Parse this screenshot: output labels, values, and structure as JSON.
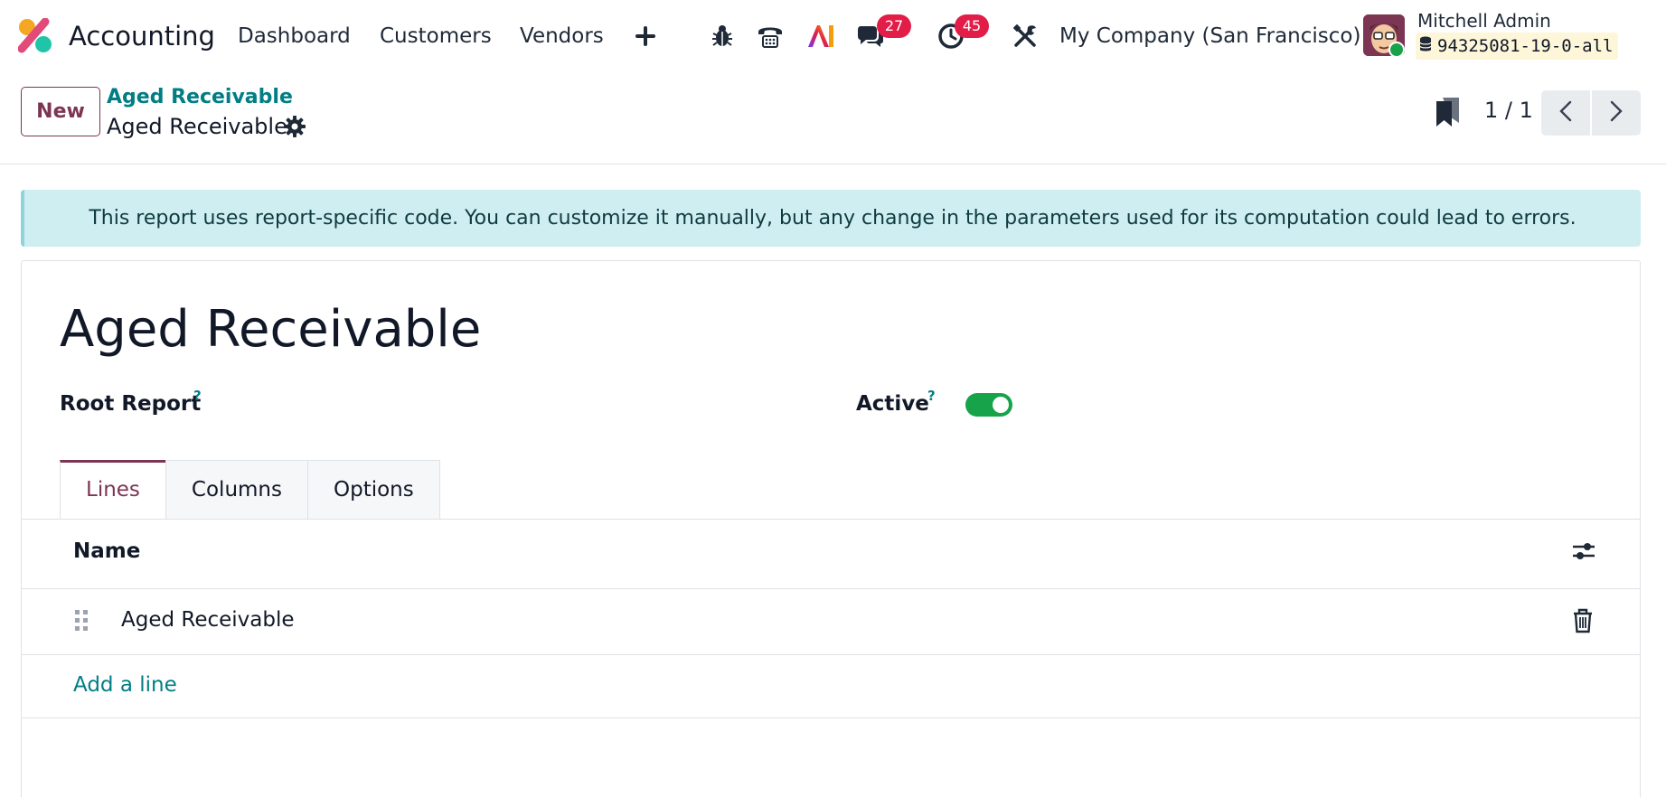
{
  "navbar": {
    "app_name": "Accounting",
    "menu": [
      "Dashboard",
      "Customers",
      "Vendors"
    ],
    "icons": [
      "plus-icon",
      "bug-icon",
      "phone-icon",
      "ai-icon",
      "chat-icon",
      "activity-clock-icon",
      "tools-icon"
    ],
    "messages_count": "27",
    "activities_count": "45",
    "company": "My Company (San Francisco)",
    "user_name": "Mitchell Admin",
    "database": "94325081-19-0-all"
  },
  "control": {
    "new_label": "New",
    "breadcrumb_parent": "Aged Receivable",
    "breadcrumb_current": "Aged Receivable",
    "pager": "1 / 1"
  },
  "alert": {
    "text": "This report uses report-specific code. You can customize it manually, but any change in the parameters used for its computation could lead to errors."
  },
  "form": {
    "title": "Aged Receivable",
    "root_report_label": "Root Report",
    "active_label": "Active",
    "help_mark": "?",
    "active": true,
    "tabs": [
      "Lines",
      "Columns",
      "Options"
    ],
    "active_tab": "Lines",
    "lines": {
      "header_name": "Name",
      "rows": [
        "Aged Receivable"
      ],
      "add_line": "Add a line"
    }
  },
  "colors": {
    "brand": "#7c3553",
    "link": "#017e84",
    "badge": "#e11d48",
    "toggle_on": "#16a34a",
    "alert_bg": "#cfeef1"
  }
}
